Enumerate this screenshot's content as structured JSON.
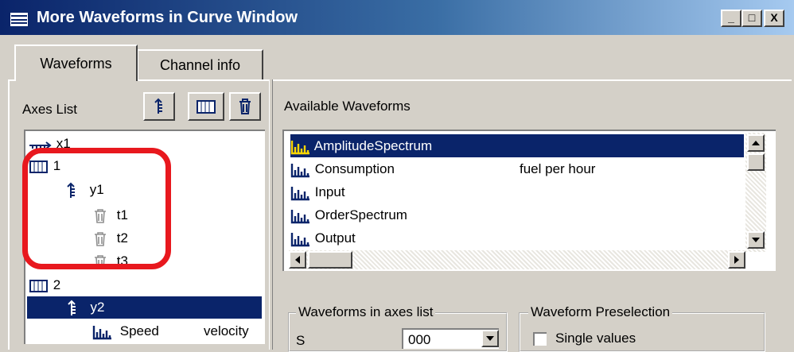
{
  "window": {
    "title": "More Waveforms in Curve Window",
    "controls": [
      "_",
      "□",
      "X"
    ]
  },
  "tabs": [
    {
      "label": "Waveforms",
      "active": true
    },
    {
      "label": "Channel info",
      "active": false
    }
  ],
  "axes_panel": {
    "label": "Axes List",
    "toolbar": [
      {
        "name": "add-y-axis",
        "icon": "y-axis-icon"
      },
      {
        "name": "add-window",
        "icon": "window-icon"
      },
      {
        "name": "delete",
        "icon": "trash-icon"
      }
    ],
    "tree": [
      {
        "text": "x1",
        "icon": "x-axis-icon",
        "level": 0
      },
      {
        "text": "1",
        "icon": "window-icon",
        "level": 0
      },
      {
        "text": "y1",
        "icon": "y-axis-icon",
        "level": 1
      },
      {
        "text": "t1",
        "icon": "trash-icon",
        "level": 2
      },
      {
        "text": "t2",
        "icon": "trash-icon",
        "level": 2
      },
      {
        "text": "t3",
        "icon": "trash-icon",
        "level": 2
      },
      {
        "text": "2",
        "icon": "window-icon",
        "level": 0
      },
      {
        "text": "y2",
        "icon": "y-axis-icon",
        "level": 1,
        "selected": true
      },
      {
        "text": "Speed",
        "comment": "velocity",
        "icon": "waveform-icon",
        "level": 2
      }
    ]
  },
  "waveforms_panel": {
    "label": "Available Waveforms",
    "items": [
      {
        "name": "AmplitudeSpectrum",
        "comment": "",
        "selected": true
      },
      {
        "name": "Consumption",
        "comment": "fuel per hour"
      },
      {
        "name": "Input",
        "comment": ""
      },
      {
        "name": "OrderSpectrum",
        "comment": ""
      },
      {
        "name": "Output",
        "comment": ""
      }
    ]
  },
  "group_axes_list": {
    "title": "Waveforms in axes list",
    "row_label": "S",
    "field_value": "000"
  },
  "group_preselection": {
    "title": "Waveform Preselection",
    "checkbox_label": "Single values"
  },
  "colors": {
    "selection": "#0a246a",
    "highlight_outline": "#e8181e",
    "face": "#d4d0c8"
  }
}
